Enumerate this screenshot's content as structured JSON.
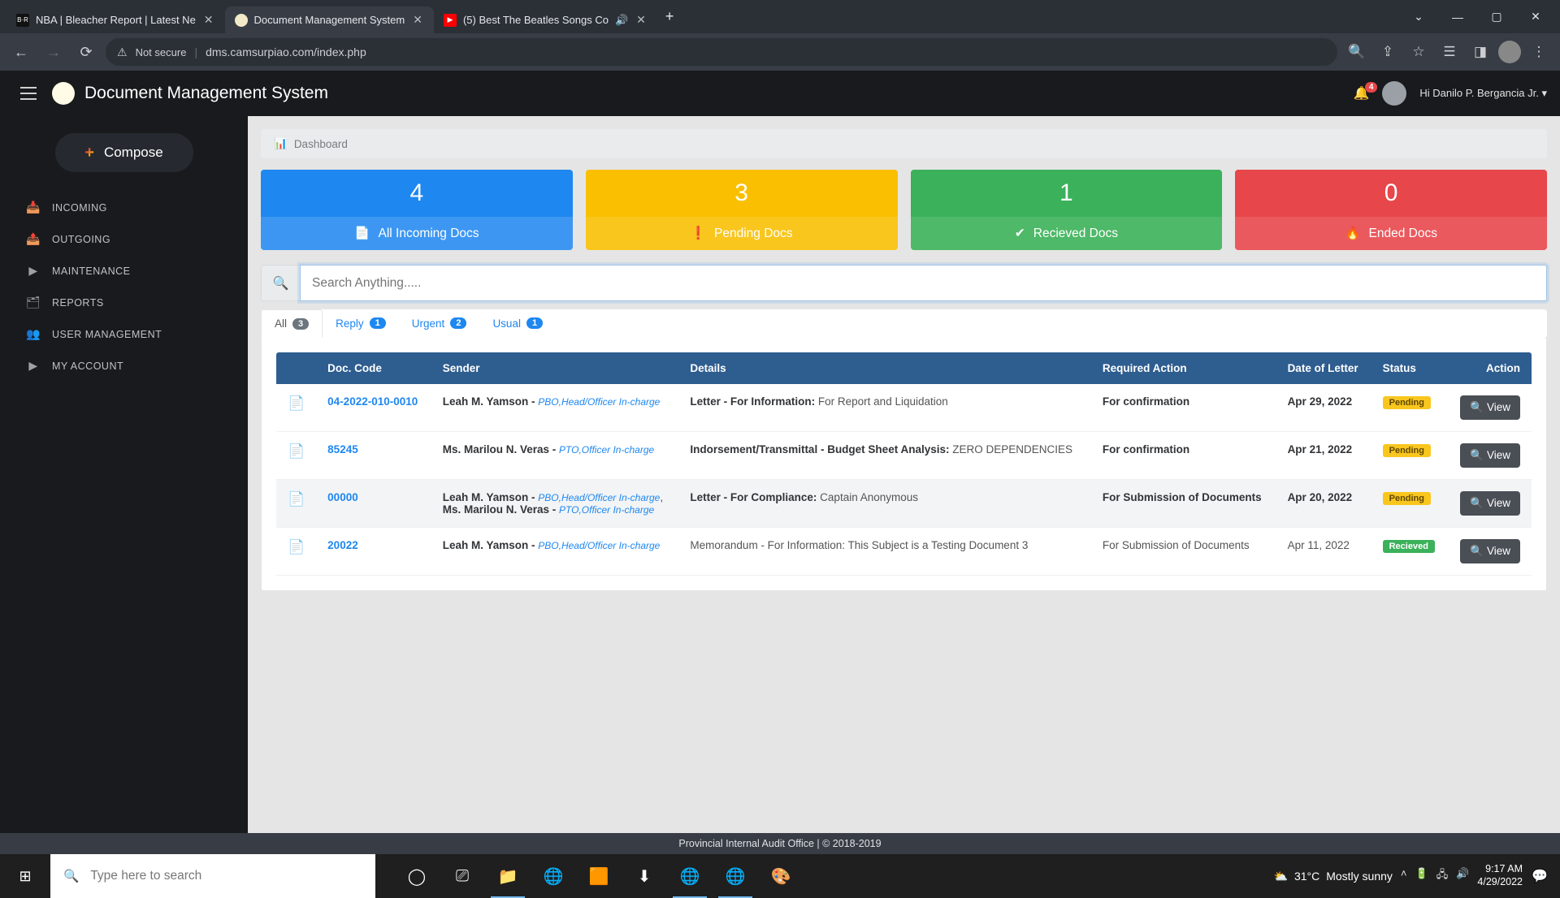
{
  "browser": {
    "tabs": [
      {
        "title": "NBA | Bleacher Report | Latest Ne",
        "icon_bg": "#111",
        "icon_txt": "B·R"
      },
      {
        "title": "Document Management System",
        "icon_bg": "#f2e9c9",
        "icon_txt": ""
      },
      {
        "title": "(5) Best The Beatles Songs Co",
        "icon_bg": "#ff0000",
        "icon_txt": "▶"
      }
    ],
    "url_warn": "Not secure",
    "url": "dms.camsurpiao.com/index.php"
  },
  "app": {
    "title": "Document Management System",
    "notify_count": "4",
    "user_greeting": "Hi Danilo P. Bergancia Jr."
  },
  "sidebar": {
    "compose": "Compose",
    "items": [
      {
        "icon": "📥",
        "label": "INCOMING"
      },
      {
        "icon": "📤",
        "label": "OUTGOING"
      },
      {
        "icon": "▶",
        "label": "MAINTENANCE"
      },
      {
        "icon": "🗂",
        "label": "REPORTS"
      },
      {
        "icon": "👥",
        "label": "USER MANAGEMENT"
      },
      {
        "icon": "▶",
        "label": "MY ACCOUNT"
      }
    ]
  },
  "breadcrumb": "Dashboard",
  "cards": [
    {
      "count": "4",
      "label": "All Incoming Docs",
      "icon": "📄"
    },
    {
      "count": "3",
      "label": "Pending Docs",
      "icon": "❗"
    },
    {
      "count": "1",
      "label": "Recieved Docs",
      "icon": "✔"
    },
    {
      "count": "0",
      "label": "Ended Docs",
      "icon": "🔥"
    }
  ],
  "search": {
    "placeholder": "Search Anything....."
  },
  "filters": [
    {
      "label": "All",
      "count": "3"
    },
    {
      "label": "Reply",
      "count": "1"
    },
    {
      "label": "Urgent",
      "count": "2"
    },
    {
      "label": "Usual",
      "count": "1"
    }
  ],
  "table": {
    "headers": [
      "",
      "Doc. Code",
      "Sender",
      "Details",
      "Required Action",
      "Date of Letter",
      "Status",
      "Action"
    ],
    "view_label": "View",
    "rows": [
      {
        "code": "04-2022-010-0010",
        "senders": [
          {
            "name": "Leah M. Yamson",
            "role": "PBO,Head/Officer In-charge"
          }
        ],
        "det_label": "Letter - For Information:",
        "det_body": "For Report and Liquidation",
        "action": "For confirmation",
        "date": "Apr 29, 2022",
        "status": "Pending",
        "status_cls": "st-pending",
        "bold": true
      },
      {
        "code": "85245",
        "senders": [
          {
            "name": "Ms. Marilou N. Veras",
            "role": "PTO,Officer In-charge"
          }
        ],
        "det_label": "Indorsement/Transmittal - Budget Sheet Analysis:",
        "det_body": "ZERO DEPENDENCIES",
        "action": "For confirmation",
        "date": "Apr 21, 2022",
        "status": "Pending",
        "status_cls": "st-pending",
        "bold": true
      },
      {
        "code": "00000",
        "senders": [
          {
            "name": "Leah M. Yamson",
            "role": "PBO,Head/Officer In-charge"
          },
          {
            "name": "Ms. Marilou N. Veras",
            "role": "PTO,Officer In-charge"
          }
        ],
        "det_label": "Letter - For Compliance:",
        "det_body": "Captain Anonymous",
        "action": "For Submission of Documents",
        "date": "Apr 20, 2022",
        "status": "Pending",
        "status_cls": "st-pending",
        "bold": true,
        "hi": true
      },
      {
        "code": "20022",
        "senders": [
          {
            "name": "Leah M. Yamson",
            "role": "PBO,Head/Officer In-charge"
          }
        ],
        "det_label": "",
        "det_body": "Memorandum - For Information: This Subject is a Testing Document 3",
        "action": "For Submission of Documents",
        "date": "Apr 11, 2022",
        "status": "Recieved",
        "status_cls": "st-recieved",
        "bold": false
      }
    ]
  },
  "footer": "Provincial Internal Audit Office | © 2018-2019",
  "taskbar": {
    "search_placeholder": "Type here to search",
    "weather_temp": "31°C",
    "weather_desc": "Mostly sunny",
    "time": "9:17 AM",
    "date": "4/29/2022"
  }
}
